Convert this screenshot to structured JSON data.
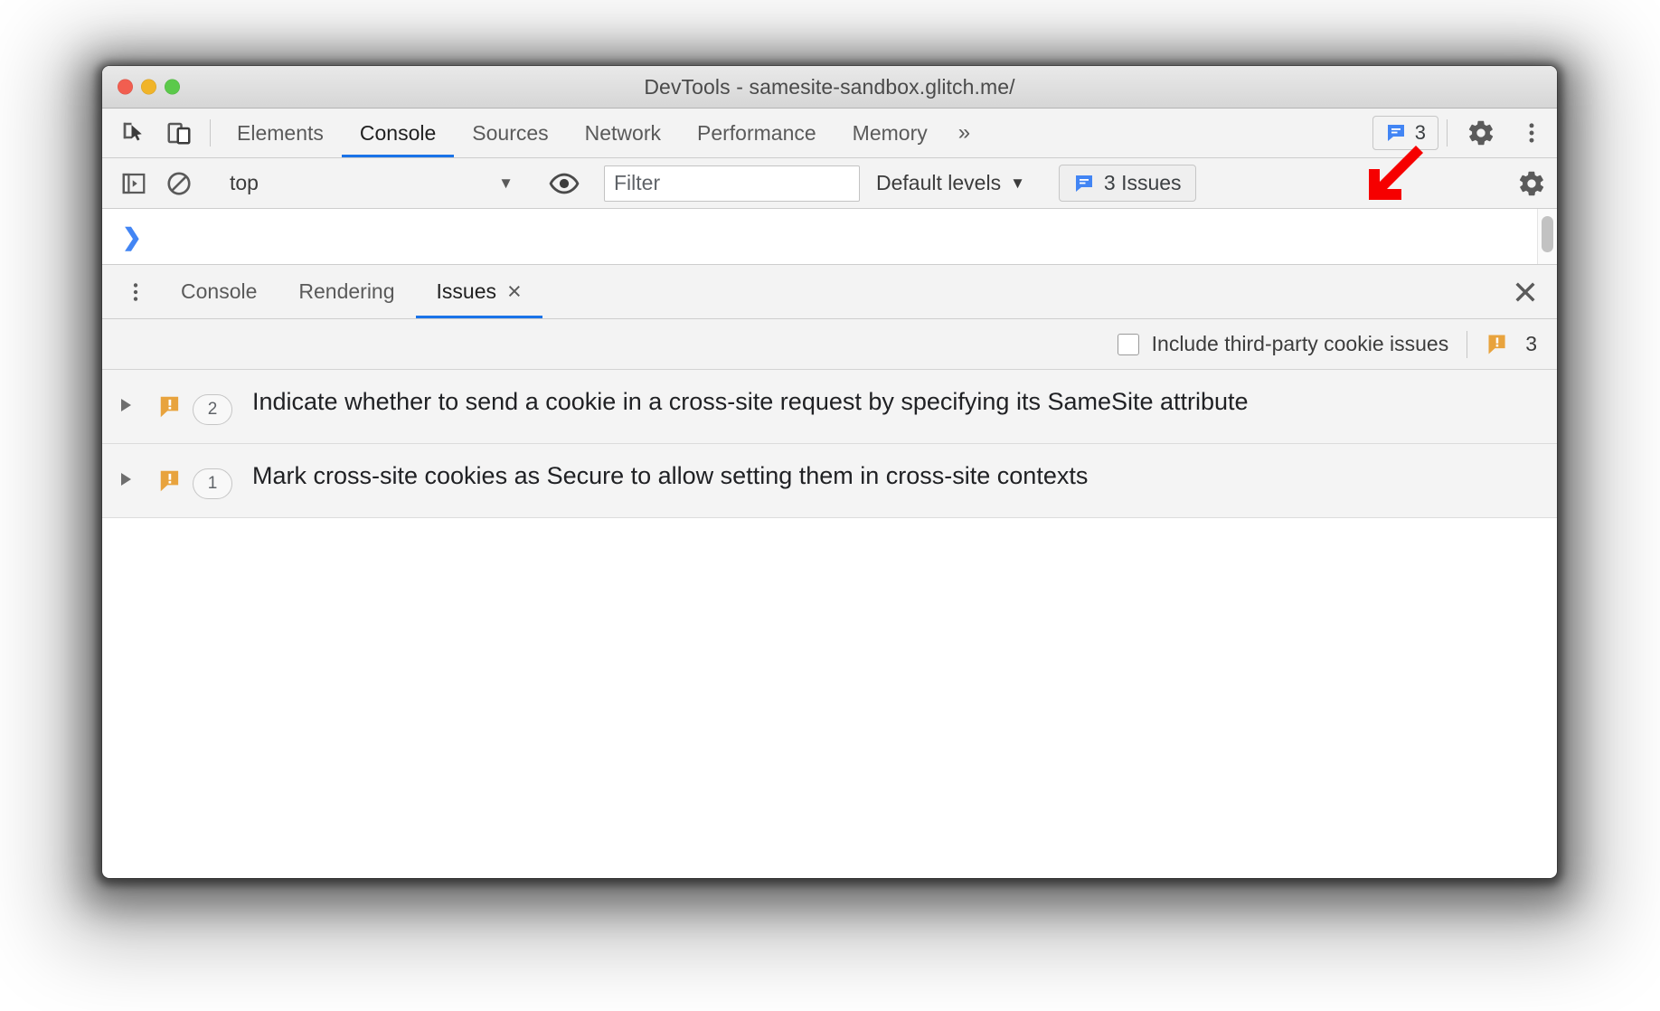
{
  "window": {
    "title": "DevTools - samesite-sandbox.glitch.me/",
    "traffic_lights": [
      "close",
      "minimize",
      "zoom"
    ]
  },
  "main_tabs": {
    "icons": [
      {
        "name": "inspect-element-icon"
      },
      {
        "name": "device-toolbar-icon"
      }
    ],
    "tabs": [
      {
        "label": "Elements",
        "active": false
      },
      {
        "label": "Console",
        "active": true
      },
      {
        "label": "Sources",
        "active": false
      },
      {
        "label": "Network",
        "active": false
      },
      {
        "label": "Performance",
        "active": false
      },
      {
        "label": "Memory",
        "active": false
      }
    ],
    "more_tabs_label": "»",
    "issues_badge_count": "3",
    "settings_icon": "gear-icon",
    "menu_icon": "kebab-menu-icon"
  },
  "console_toolbar": {
    "sidebar_toggle_icon": "console-sidebar-icon",
    "clear_icon": "clear-console-icon",
    "context_value": "top",
    "context_caret": "▼",
    "live_expression_icon": "eye-icon",
    "filter_placeholder": "Filter",
    "filter_value": "",
    "levels_label": "Default levels",
    "levels_caret": "▼",
    "issues_chip_label": "3 Issues",
    "settings_icon": "gear-icon"
  },
  "console_prompt": {
    "chevron": "❯"
  },
  "drawer": {
    "menu_icon": "kebab-menu-icon",
    "tabs": [
      {
        "label": "Console",
        "active": false,
        "closable": false
      },
      {
        "label": "Rendering",
        "active": false,
        "closable": false
      },
      {
        "label": "Issues",
        "active": true,
        "closable": true,
        "close_glyph": "×"
      }
    ],
    "close_drawer_glyph": "×"
  },
  "issues_panel": {
    "third_party_label": "Include third-party cookie issues",
    "third_party_checked": false,
    "warning_count": "3",
    "warning_icon": "warning-breaking-change-icon",
    "issues": [
      {
        "count": "2",
        "icon": "warning-breaking-change-icon",
        "title": "Indicate whether to send a cookie in a cross-site request by specifying its SameSite attribute",
        "expanded": false
      },
      {
        "count": "1",
        "icon": "warning-breaking-change-icon",
        "title": "Mark cross-site cookies as Secure to allow setting them in cross-site contexts",
        "expanded": false
      }
    ]
  },
  "annotation": {
    "arrow_icon": "red-arrow-down-left-icon",
    "arrow_color": "#f60000"
  },
  "colors": {
    "accent_blue": "#1a73e8",
    "warning_orange": "#e8a33d",
    "issue_blue": "#4285f4",
    "toolbar_bg": "#f3f3f3",
    "row_bg": "#f4f4f4"
  }
}
